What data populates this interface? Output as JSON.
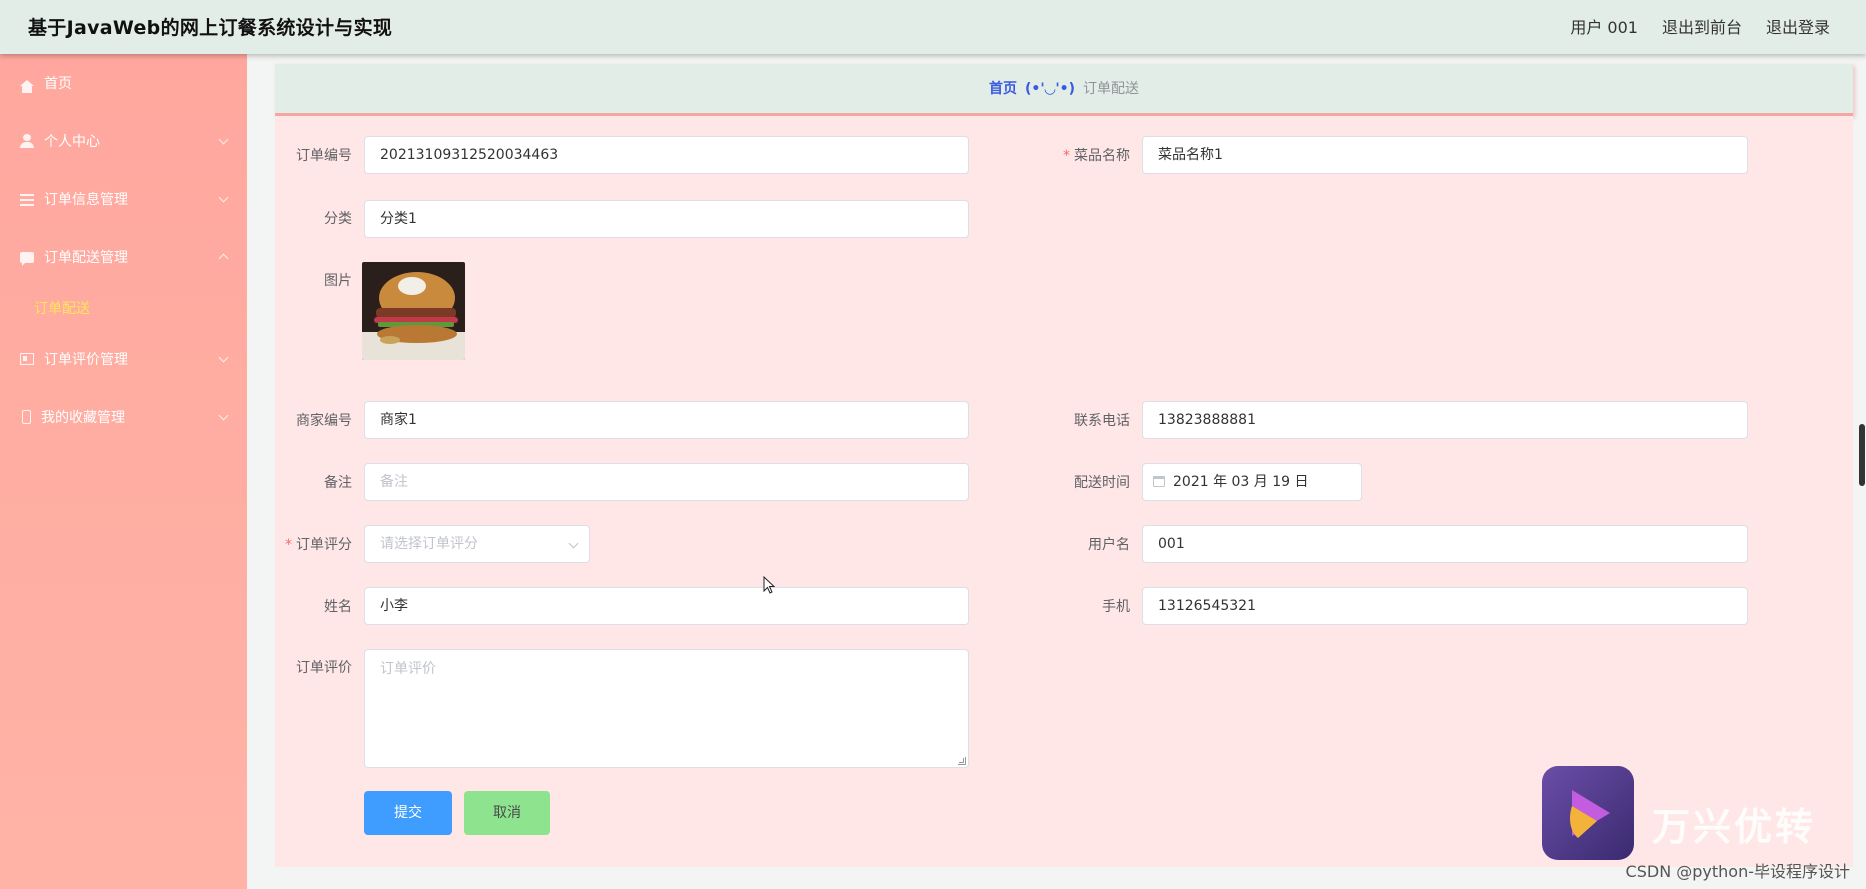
{
  "header": {
    "title": "基于JavaWeb的网上订餐系统设计与实现",
    "user_label": "用户 001",
    "to_front": "退出到前台",
    "logout": "退出登录"
  },
  "sidebar": {
    "items": [
      {
        "label": "首页"
      },
      {
        "label": "个人中心"
      },
      {
        "label": "订单信息管理"
      },
      {
        "label": "订单配送管理",
        "children": [
          {
            "label": "订单配送"
          }
        ]
      },
      {
        "label": "订单评价管理"
      },
      {
        "label": "我的收藏管理"
      }
    ]
  },
  "breadcrumb": {
    "home": "首页",
    "face": "(•'◡'•)",
    "current": "订单配送"
  },
  "form": {
    "order_no": {
      "label": "订单编号",
      "value": "20213109312520034463"
    },
    "dish_name": {
      "label": "菜品名称",
      "value": "菜品名称1"
    },
    "category": {
      "label": "分类",
      "value": "分类1"
    },
    "image": {
      "label": "图片"
    },
    "merchant_no": {
      "label": "商家编号",
      "value": "商家1"
    },
    "phone": {
      "label": "联系电话",
      "value": "13823888881"
    },
    "remark": {
      "label": "备注",
      "placeholder": "备注"
    },
    "delivery_time": {
      "label": "配送时间",
      "value": "2021 年 03 月 19 日"
    },
    "rating": {
      "label": "订单评分",
      "placeholder": "请选择订单评分"
    },
    "username": {
      "label": "用户名",
      "value": "001"
    },
    "name": {
      "label": "姓名",
      "value": "小李"
    },
    "mobile": {
      "label": "手机",
      "value": "13126545321"
    },
    "review": {
      "label": "订单评价",
      "placeholder": "订单评价"
    },
    "submit": "提交",
    "cancel": "取消"
  },
  "watermark": {
    "brand": "万兴优转",
    "credit": "CSDN @python-毕设程序设计"
  },
  "colors": {
    "sidebar_bg": "#ffa79e",
    "submenu_active": "#ffe45c",
    "submit_btn": "#3f9dff",
    "cancel_btn": "#8ee38e",
    "content_bg": "#ffe7e7",
    "header_bg": "#e3ede8"
  }
}
